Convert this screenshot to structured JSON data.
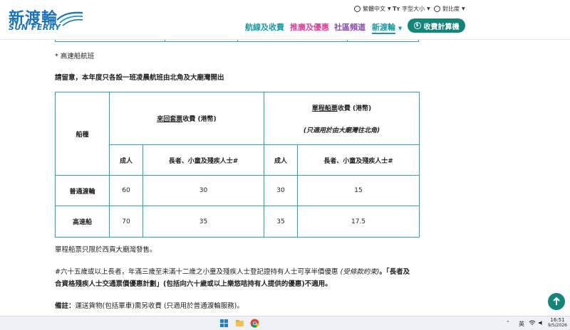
{
  "header": {
    "logo_cn": "新渡輪",
    "logo_en": "SUN FERRY",
    "language": "繁體中文",
    "font_size": "字型大小",
    "contrast": "對比度",
    "nav": [
      "航線及收費",
      "推廣及優惠",
      "社區頻道",
      "新渡輪"
    ],
    "nav_colors": [
      "#1a9ba3",
      "#e0409a",
      "#8a4bb0",
      "#1a9ba3"
    ],
    "calc_label": "收費計算機",
    "calc_icon": "$",
    "text_icon": "Tт"
  },
  "content": {
    "note_fast": "* 高速船航班",
    "notice": "請留意，本年度只各設一班凌晨航班由北角及大廟灣開出",
    "table": {
      "vessel_header": "船種",
      "return_prefix": "來回套票",
      "return_suffix": "收費 (港幣)",
      "single_prefix": "單程船票",
      "single_suffix": "收費 (港幣)",
      "single_note": "(只適用於由大廟灣往北角)",
      "adult": "成人",
      "concession": "長者、小童及殘疾人士#",
      "rows": [
        {
          "type": "普通渡輪",
          "values": [
            "60",
            "30",
            "30",
            "15"
          ]
        },
        {
          "type": "高速船",
          "values": [
            "70",
            "35",
            "35",
            "17.5"
          ]
        }
      ]
    },
    "single_note_text": "單程船票只限於西貢大廟灣發售。",
    "hash_note_1a": "#六十五歲或以上長者，年滿三歲至未滿十二歲之小童及殘疾人士登記證持有人士可享半價優惠",
    "hash_note_1b": "(受條款約束)",
    "hash_note_1c": "。「長者及",
    "hash_note_2": "合資格殘疾人士交通票價優惠計劃」(包括向六十歲或以上樂悠咭持有人提供的優惠)不適用。",
    "remark_label": "備註：",
    "remark_text": "運送貨物(包括單車)需另收費 (只適用於普通渡輪服務)。"
  },
  "taskbar": {
    "ime": "英",
    "time": "16:51",
    "date": "9/5/2026"
  }
}
